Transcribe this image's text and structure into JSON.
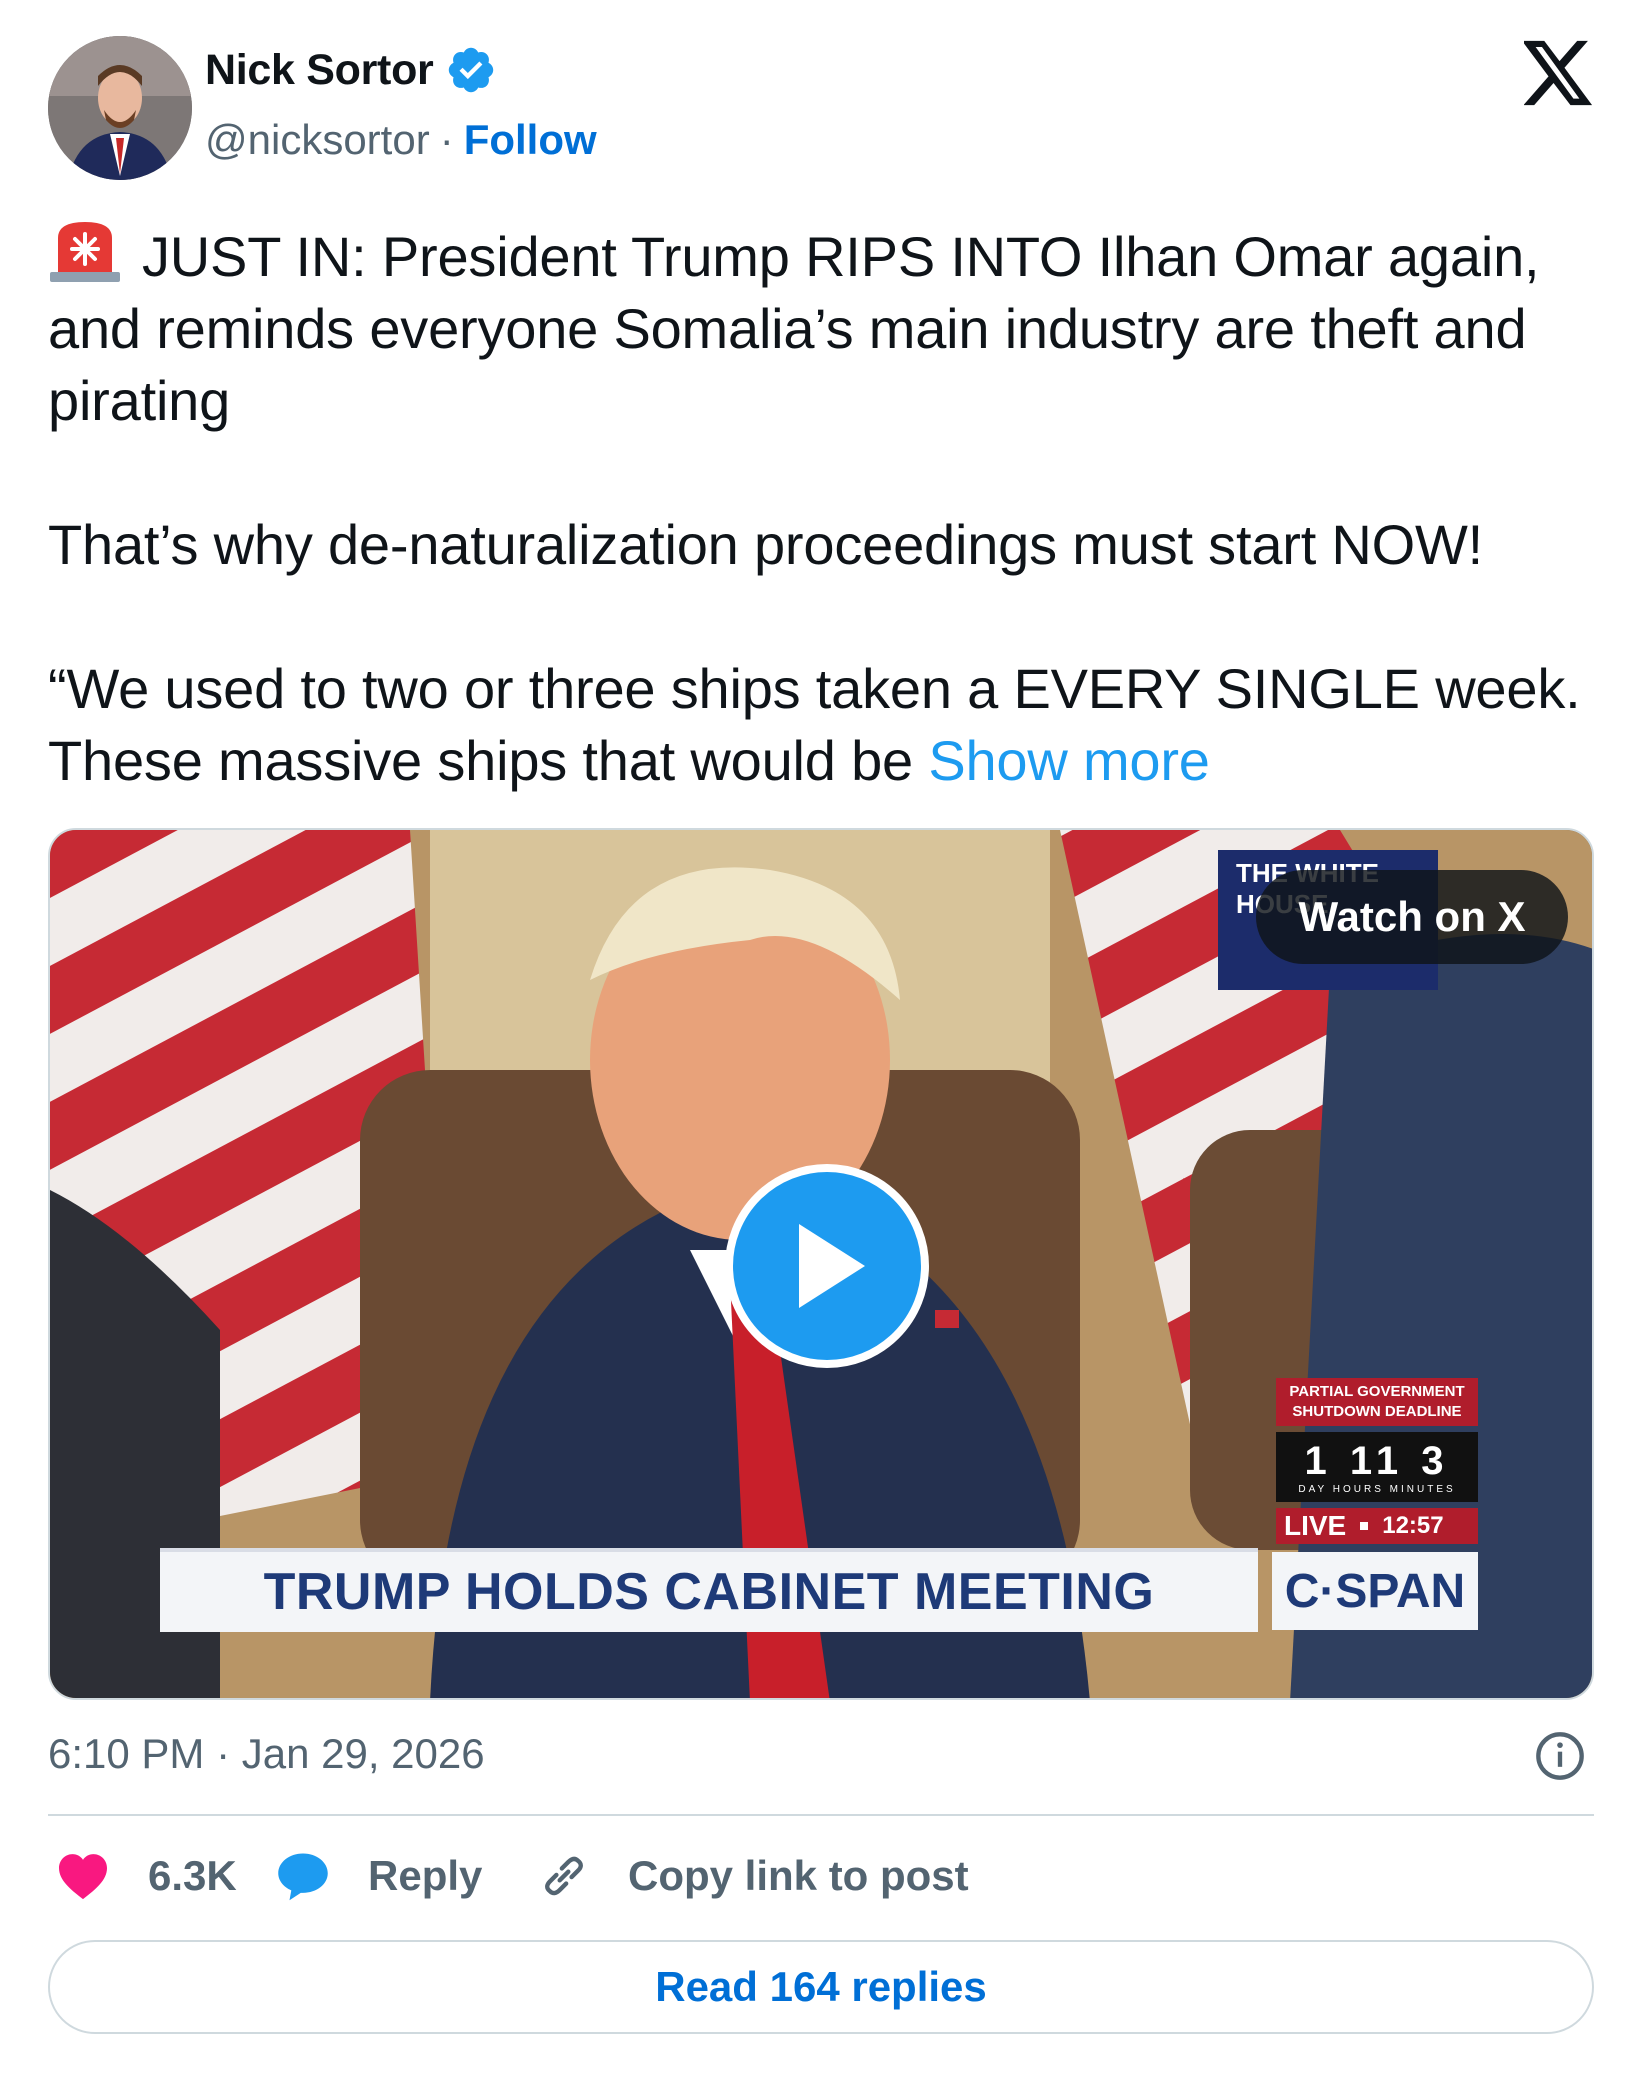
{
  "author": {
    "name": "Nick Sortor",
    "handle": "@nicksortor",
    "separator": "·",
    "follow_label": "Follow",
    "verified": true
  },
  "brand_icon": "x-logo-icon",
  "tweet": {
    "line1": "JUST IN: President Trump RIPS INTO Ilhan Omar again, and reminds everyone Somalia’s main industry are theft and pirating",
    "line2": "That’s why de-naturalization proceedings must start NOW!",
    "line3": "“We used to two or three ships taken a EVERY SINGLE week. These massive ships that would be",
    "show_more": "Show more",
    "emoji_icon": "police-siren-icon"
  },
  "video": {
    "watch_label": "Watch on X",
    "badge_text": "THE WHITE HOUSE",
    "lower_third": "TRUMP HOLDS CABINET MEETING",
    "network": "C·SPAN",
    "countdown_title": "PARTIAL GOVERNMENT SHUTDOWN DEADLINE",
    "countdown_values": "1  11  3",
    "countdown_units": "DAY  HOURS  MINUTES",
    "live_label": "LIVE",
    "live_time": "12:57"
  },
  "meta": {
    "timestamp": "6:10 PM · Jan 29, 2026"
  },
  "actions": {
    "likes": "6.3K",
    "reply": "Reply",
    "copy_link": "Copy link to post"
  },
  "read_replies": "Read 164 replies",
  "colors": {
    "link": "#1d9bf0",
    "follow": "#006fd6",
    "heart": "#f91880",
    "muted": "#536471"
  }
}
